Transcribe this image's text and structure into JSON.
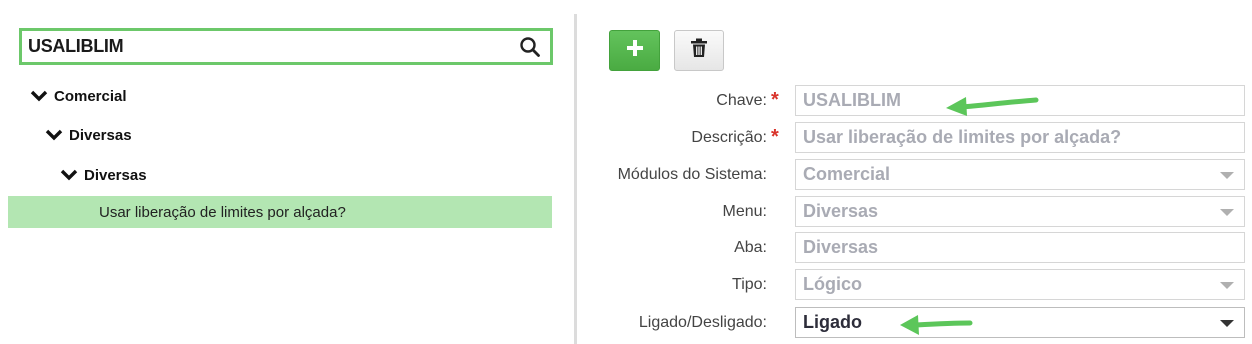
{
  "search": {
    "value": "USALIBLIM"
  },
  "tree": {
    "level1": "Comercial",
    "level2": "Diversas",
    "level3": "Diversas",
    "leaf": "Usar liberação de limites por alçada?"
  },
  "toolbar": {
    "add_icon": "plus-icon",
    "delete_icon": "trash-icon"
  },
  "form": {
    "required_mark": "*",
    "chave": {
      "label": "Chave:",
      "value": "USALIBLIM"
    },
    "descricao": {
      "label": "Descrição:",
      "value": "Usar liberação de limites por alçada?"
    },
    "modulos": {
      "label": "Módulos do Sistema:",
      "value": "Comercial"
    },
    "menu": {
      "label": "Menu:",
      "value": "Diversas"
    },
    "aba": {
      "label": "Aba:",
      "value": "Diversas"
    },
    "tipo": {
      "label": "Tipo:",
      "value": "Lógico"
    },
    "ligado": {
      "label": "Ligado/Desligado:",
      "value": "Ligado"
    }
  },
  "colors": {
    "accent_green": "#6cc86a",
    "selected_row": "#b3e6b2",
    "required_red": "#d9342b",
    "annotation_arrow": "#5cc65a"
  }
}
